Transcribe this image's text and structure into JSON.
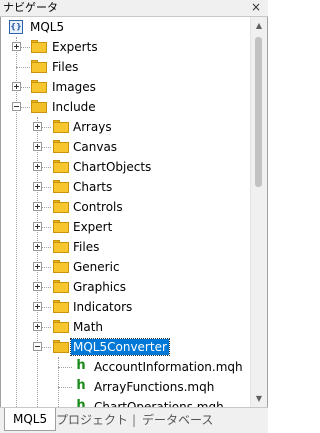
{
  "window": {
    "title": "ナビゲータ",
    "close_glyph": "×"
  },
  "tree": {
    "root": {
      "label": "MQL5",
      "icon": "mql5-root-icon"
    },
    "top_folders": [
      {
        "label": "Experts",
        "expanded": false
      },
      {
        "label": "Files",
        "expanded": false,
        "has_children": false
      },
      {
        "label": "Images",
        "expanded": false
      },
      {
        "label": "Include",
        "expanded": true
      }
    ],
    "include_children": [
      {
        "label": "Arrays"
      },
      {
        "label": "Canvas"
      },
      {
        "label": "ChartObjects"
      },
      {
        "label": "Charts"
      },
      {
        "label": "Controls"
      },
      {
        "label": "Expert"
      },
      {
        "label": "Files"
      },
      {
        "label": "Generic"
      },
      {
        "label": "Graphics"
      },
      {
        "label": "Indicators"
      },
      {
        "label": "Math"
      },
      {
        "label": "MQL5Converter",
        "selected": true,
        "expanded": true
      }
    ],
    "converter_files": [
      {
        "label": "AccountInformation.mqh"
      },
      {
        "label": "ArrayFunctions.mqh"
      },
      {
        "label": "ChartOperations.mqh"
      }
    ]
  },
  "tabs": [
    {
      "label": "MQL5",
      "active": true
    },
    {
      "label": "プロジェクト",
      "active": false
    },
    {
      "label": "データベース",
      "active": false
    }
  ],
  "tab_separator": "|",
  "colors": {
    "selection": "#0078d7",
    "folder": "#f7c52d",
    "file_icon": "#1a8a1a"
  }
}
